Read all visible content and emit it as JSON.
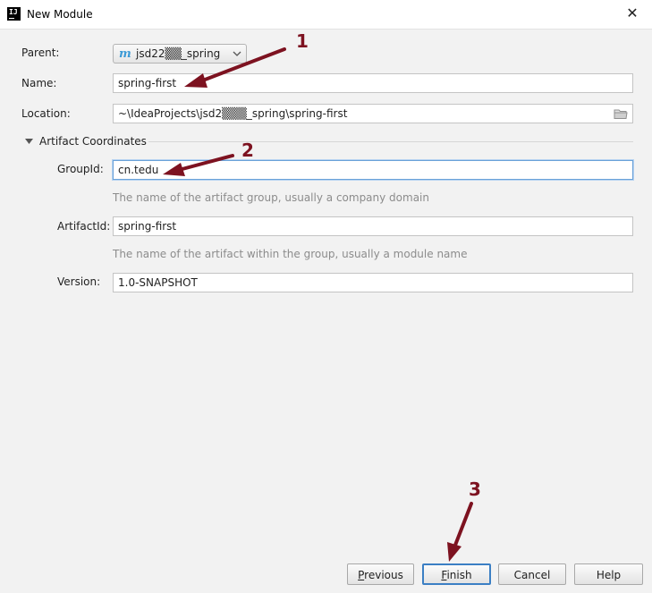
{
  "window": {
    "title": "New Module",
    "close_glyph": "✕"
  },
  "app_icon": {
    "text": "IJ"
  },
  "form": {
    "parent_label": "Parent:",
    "parent_value": "jsd22▒▒_spring",
    "parent_icon_glyph": "m",
    "name_label": "Name:",
    "name_value": "spring-first",
    "location_label": "Location:",
    "location_value": "~\\IdeaProjects\\jsd2▒▒▒_spring\\spring-first",
    "section_title": "Artifact Coordinates",
    "group_label": "GroupId:",
    "group_value": "cn.tedu",
    "group_hint": "The name of the artifact group, usually a company domain",
    "artifact_label": "ArtifactId:",
    "artifact_value": "spring-first",
    "artifact_hint": "The name of the artifact within the group, usually a module name",
    "version_label": "Version:",
    "version_value": "1.0-SNAPSHOT"
  },
  "buttons": {
    "previous": {
      "mnemonic": "P",
      "rest": "revious"
    },
    "finish": {
      "mnemonic": "F",
      "rest": "inish"
    },
    "cancel": "Cancel",
    "help": "Help"
  },
  "annotations": [
    "1",
    "2",
    "3"
  ],
  "colors": {
    "annotation": "#7d1220",
    "focus_border": "#6aa1d8",
    "default_button_border": "#3b7fc4",
    "hint_text": "#8c8c8c",
    "maven_icon": "#3c9ad6"
  },
  "icons": {
    "app": "intellij-icon",
    "close": "close-icon",
    "parent_module": "maven-module-icon",
    "dropdown": "chevron-down-icon",
    "browse": "folder-icon",
    "section_toggle": "triangle-down-icon"
  }
}
